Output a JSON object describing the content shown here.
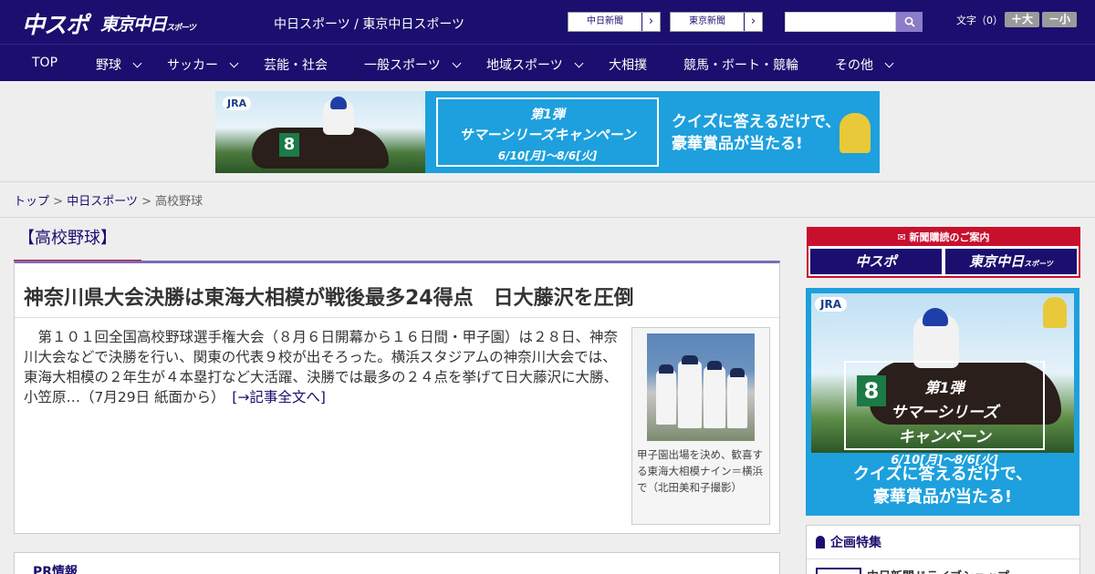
{
  "header": {
    "logo_chunichi_sports": "中スポ",
    "logo_tokyo_chunichi": "東京中日",
    "logo_tokyo_suffix": "スポーツ",
    "site_names": "中日スポーツ / 東京中日スポーツ",
    "paper_links": [
      {
        "label": "中日新聞"
      },
      {
        "label": "東京新聞"
      }
    ],
    "search": {
      "placeholder": "",
      "button_icon": "search-icon"
    },
    "font_size": {
      "label": "文字（0）",
      "larger": "＋大",
      "smaller": "－小"
    },
    "colors": {
      "brand": "#1a0f6e",
      "accent_red": "#c8102e",
      "search_button": "#8a7cc8"
    }
  },
  "nav": {
    "items": [
      {
        "label": "TOP",
        "dropdown": false
      },
      {
        "label": "野球",
        "dropdown": true
      },
      {
        "label": "サッカー",
        "dropdown": true
      },
      {
        "label": "芸能・社会",
        "dropdown": false
      },
      {
        "label": "一般スポーツ",
        "dropdown": true
      },
      {
        "label": "地域スポーツ",
        "dropdown": true
      },
      {
        "label": "大相撲",
        "dropdown": false
      },
      {
        "label": "競馬・ボート・競輪",
        "dropdown": false
      },
      {
        "label": "その他",
        "dropdown": true
      }
    ]
  },
  "ad_top": {
    "jra": "JRA",
    "number": "8",
    "campaign_line1": "第1弾",
    "campaign_line2": "サマーシリーズキャンペーン",
    "campaign_dates": "6/10[月]～8/6[火]",
    "quiz_line1": "クイズに答えるだけで、",
    "quiz_line2": "豪華賞品が当たる!",
    "color": "#1da0dd"
  },
  "breadcrumb": {
    "items": [
      "トップ",
      "中日スポーツ",
      "高校野球"
    ],
    "separator": ">"
  },
  "main": {
    "category": "【高校野球】",
    "headline": "神奈川県大会決勝は東海大相模が戦後最多24得点　日大藤沢を圧倒",
    "body": "　第１０１回全国高校野球選手権大会（８月６日開幕から１６日間・甲子園）は２８日、神奈川大会などで決勝を行い、関東の代表９校が出そろった。横浜スタジアムの神奈川大会では、東海大相模の２年生が４本塁打など大活躍、決勝では最多の２４点を挙げて日大藤沢に大勝、小笠原…（7月29日 紙面から）",
    "full_article_link": "[→記事全文へ]",
    "photo_caption": "甲子園出場を決め、歓喜する東海大相模ナイン＝横浜で（北田美和子撮影）",
    "pr_title": "PR情報"
  },
  "sidebar": {
    "subscription_title": "新聞購読のご案内",
    "subscription_logos": [
      "中スポ",
      "東京中日"
    ],
    "subscription_logo_suffix": "スポーツ",
    "ad": {
      "jra": "JRA",
      "number": "8",
      "campaign_line1": "第1弾",
      "campaign_line2": "サマーシリーズ",
      "campaign_line3": "キャンペーン",
      "campaign_dates": "6/10[月]～8/6[火]",
      "quiz_line1": "クイズに答えるだけで、",
      "quiz_line2": "豪華賞品が当たる!"
    },
    "feature_title": "企画特集",
    "feature_item": "中日新聞ドライブショップ"
  }
}
